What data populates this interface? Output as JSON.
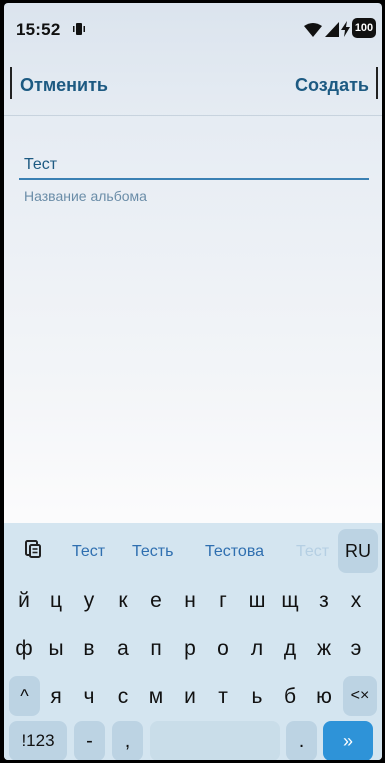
{
  "status": {
    "time": "15:52",
    "battery": "100"
  },
  "header": {
    "cancel_label": "Отменить",
    "create_label": "Создать"
  },
  "form": {
    "field_value": "Тест",
    "field_label": "Название альбома"
  },
  "keyboard": {
    "suggestions": [
      "Тест",
      "Тесть",
      "Тестова",
      "Тест"
    ],
    "language": "RU",
    "row1": [
      "й",
      "ц",
      "у",
      "к",
      "е",
      "н",
      "г",
      "ш",
      "щ",
      "з",
      "х"
    ],
    "row2": [
      "ф",
      "ы",
      "в",
      "а",
      "п",
      "р",
      "о",
      "л",
      "д",
      "ж",
      "э"
    ],
    "row3": [
      "я",
      "ч",
      "с",
      "м",
      "и",
      "т",
      "ь",
      "б",
      "ю"
    ],
    "shift": "^",
    "backspace": "<×",
    "numbers": "!123",
    "dash": "-",
    "comma": ",",
    "period": ".",
    "enter": "»"
  }
}
